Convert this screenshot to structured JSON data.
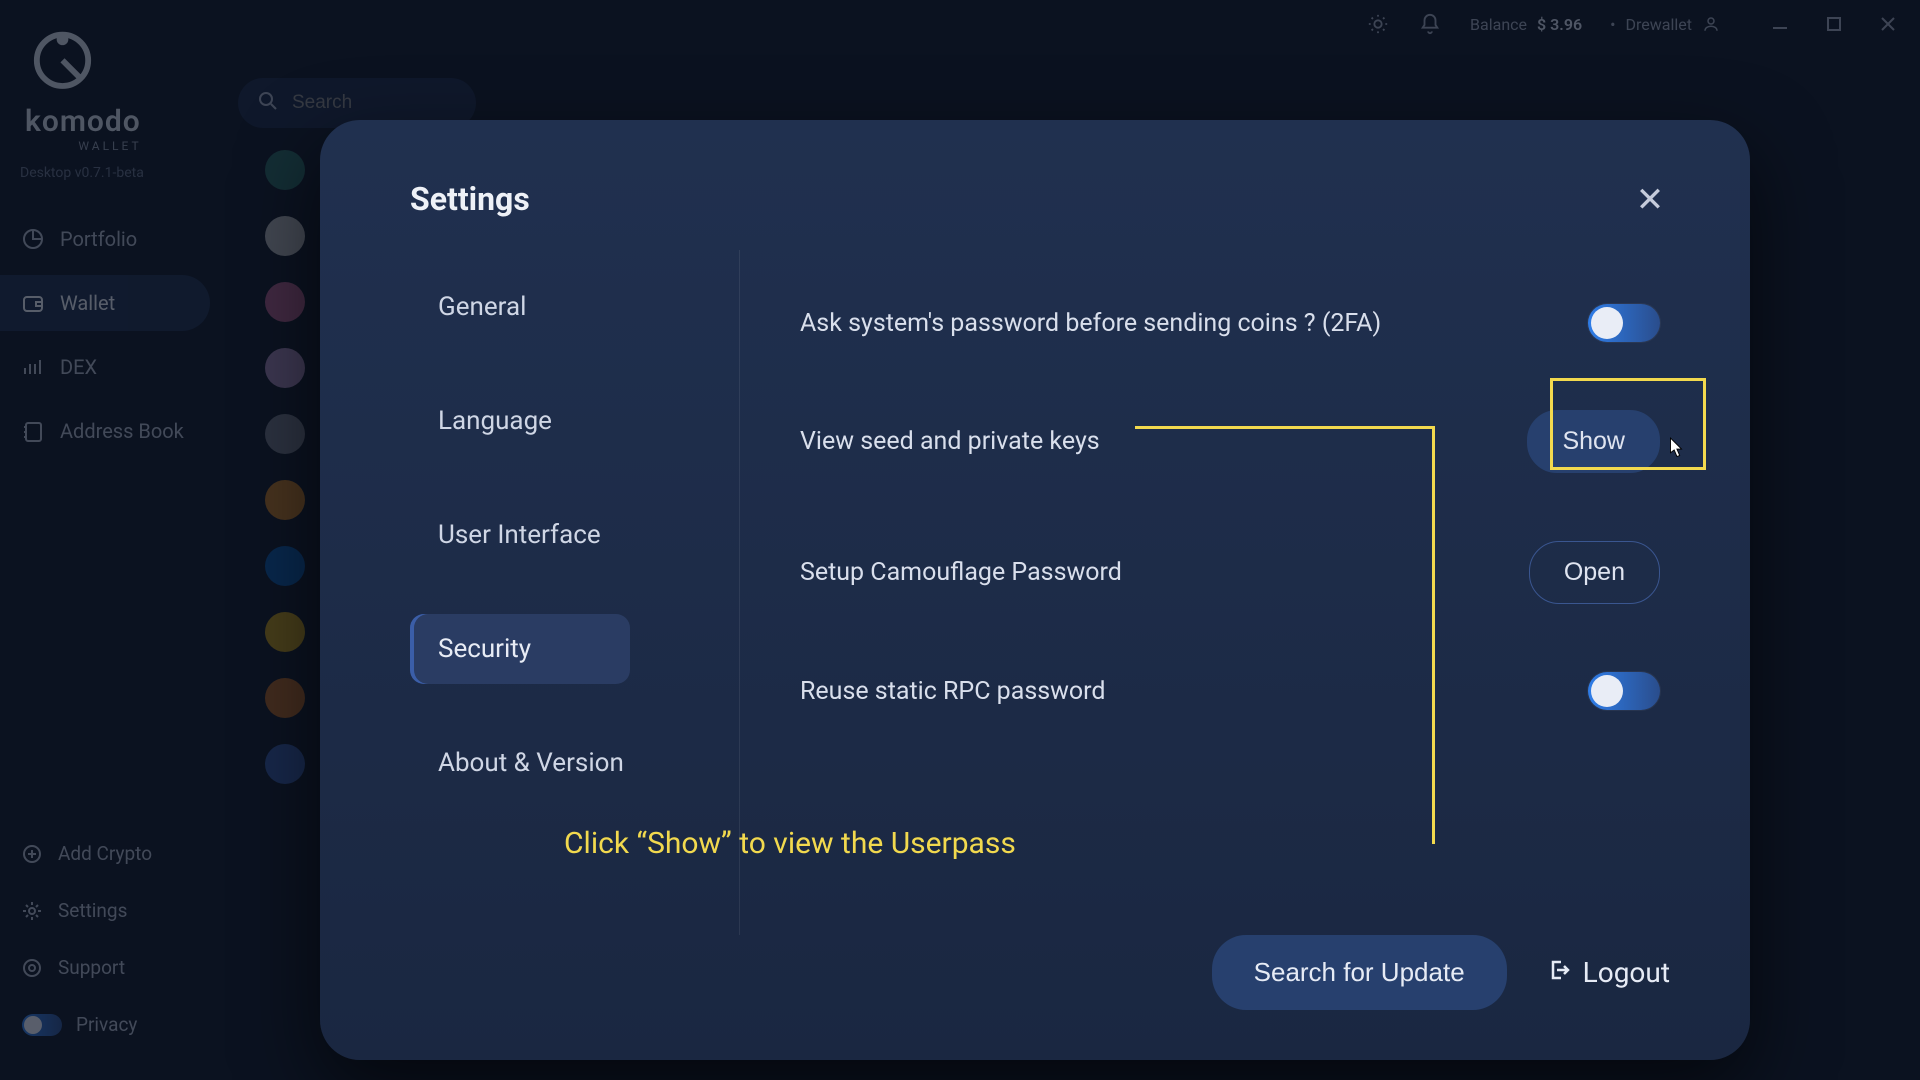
{
  "topbar": {
    "balance_label": "Balance",
    "balance_value": "$ 3.96",
    "user_name": "Drewallet"
  },
  "brand": {
    "name": "komodo",
    "sub": "WALLET"
  },
  "version": "Desktop v0.7.1-beta",
  "search": {
    "placeholder": "Search"
  },
  "nav": {
    "portfolio": "Portfolio",
    "wallet": "Wallet",
    "dex": "DEX",
    "addressbook": "Address Book",
    "addcrypto": "Add Crypto",
    "settings": "Settings",
    "support": "Support",
    "privacy": "Privacy"
  },
  "modal": {
    "title": "Settings",
    "tabs": {
      "general": "General",
      "language": "Language",
      "ui": "User Interface",
      "security": "Security",
      "about": "About & Version"
    },
    "rows": {
      "twofa": "Ask system's password before sending coins ? (2FA)",
      "seed": "View seed and private keys",
      "camo": "Setup Camouflage Password",
      "rpc": "Reuse static RPC password"
    },
    "buttons": {
      "show": "Show",
      "open": "Open"
    },
    "footer": {
      "update": "Search for Update",
      "logout": "Logout"
    }
  },
  "annotation": {
    "text": "Click “Show” to view the Userpass"
  }
}
